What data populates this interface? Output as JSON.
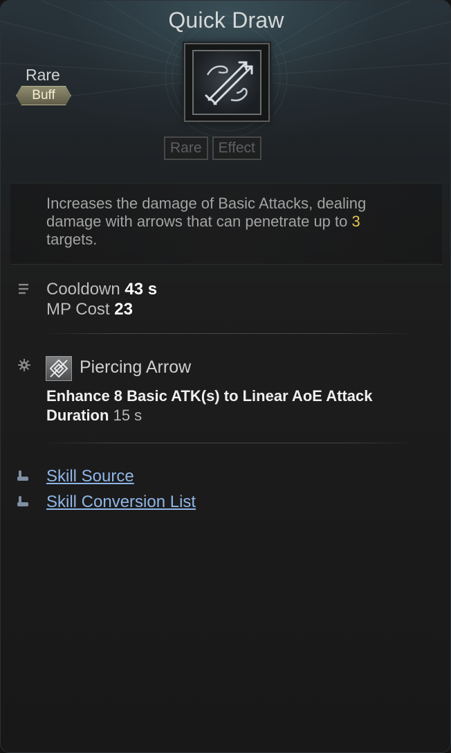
{
  "skill": {
    "name": "Quick Draw",
    "rarity": "Rare",
    "category_badge": "Buff",
    "icon": "crossed-arrows-hands-icon",
    "tags": [
      "Rare",
      "Effect"
    ]
  },
  "description": {
    "before": "Increases the damage of Basic Attacks, dealing damage with arrows that can penetrate up to ",
    "highlight": "3",
    "after": " targets."
  },
  "stats": {
    "icon": "list-lines-icon",
    "cooldown_label": "Cooldown",
    "cooldown_value": "43 s",
    "mp_label": "MP Cost",
    "mp_value": "23"
  },
  "effect": {
    "row_icon": "gear-icon",
    "icon": "piercing-arrow-icon",
    "name": "Piercing Arrow",
    "line": "Enhance 8 Basic ATK(s) to Linear AoE Attack",
    "duration_label": "Duration",
    "duration_value": "15 s"
  },
  "links": [
    {
      "label": "Skill Source",
      "icon": "pointing-hand-icon"
    },
    {
      "label": "Skill Conversion List",
      "icon": "pointing-hand-icon"
    }
  ],
  "colors": {
    "highlight": "#e6c64a",
    "link": "#8fb6e8",
    "badge": "#8e8c70"
  }
}
